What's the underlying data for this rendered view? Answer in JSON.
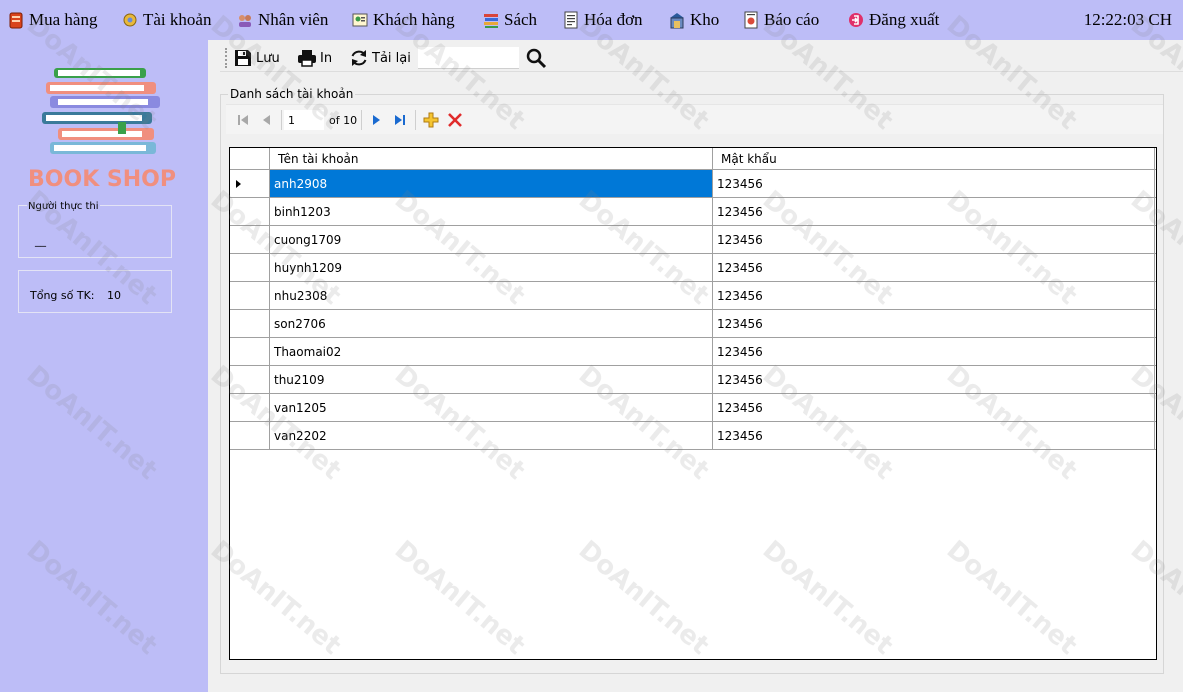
{
  "menu": {
    "items": [
      {
        "label": "Mua hàng",
        "icon": "shopping-icon"
      },
      {
        "label": "Tài khoản",
        "icon": "account-icon"
      },
      {
        "label": "Nhân viên",
        "icon": "employee-icon"
      },
      {
        "label": "Khách hàng",
        "icon": "customer-icon"
      },
      {
        "label": "Sách",
        "icon": "books-icon"
      },
      {
        "label": "Hóa đơn",
        "icon": "invoice-icon"
      },
      {
        "label": "Kho",
        "icon": "warehouse-icon"
      },
      {
        "label": "Báo cáo",
        "icon": "report-icon"
      },
      {
        "label": "Đăng xuất",
        "icon": "logout-icon"
      }
    ],
    "clock": "12:22:03 CH"
  },
  "sidebar": {
    "logo_text": "BOOK SHOP",
    "executor_label": "Người thực thi",
    "executor_value": "__",
    "total_label": "Tổng số TK:",
    "total_value": "10"
  },
  "toolbar": {
    "save_label": "Lưu",
    "print_label": "In",
    "reload_label": "Tải lại",
    "search_value": ""
  },
  "group": {
    "caption": "Danh sách tài khoản"
  },
  "navigator": {
    "position": "1",
    "of_text": "of 10"
  },
  "grid": {
    "columns": [
      "Tên tài khoản",
      "Mật khẩu"
    ],
    "selected_index": 0,
    "rows": [
      {
        "username": "anh2908",
        "password": "123456"
      },
      {
        "username": "binh1203",
        "password": "123456"
      },
      {
        "username": "cuong1709",
        "password": "123456"
      },
      {
        "username": "huynh1209",
        "password": "123456"
      },
      {
        "username": "nhu2308",
        "password": "123456"
      },
      {
        "username": "son2706",
        "password": "123456"
      },
      {
        "username": "Thaomai02",
        "password": "123456"
      },
      {
        "username": "thu2109",
        "password": "123456"
      },
      {
        "username": "van1205",
        "password": "123456"
      },
      {
        "username": "van2202",
        "password": "123456"
      }
    ]
  },
  "watermark": {
    "text": "DoAnIT.net"
  },
  "colors": {
    "menu_bg": "#bdbdf7",
    "selection": "#0078d7",
    "logo_text": "#f08f7f"
  }
}
